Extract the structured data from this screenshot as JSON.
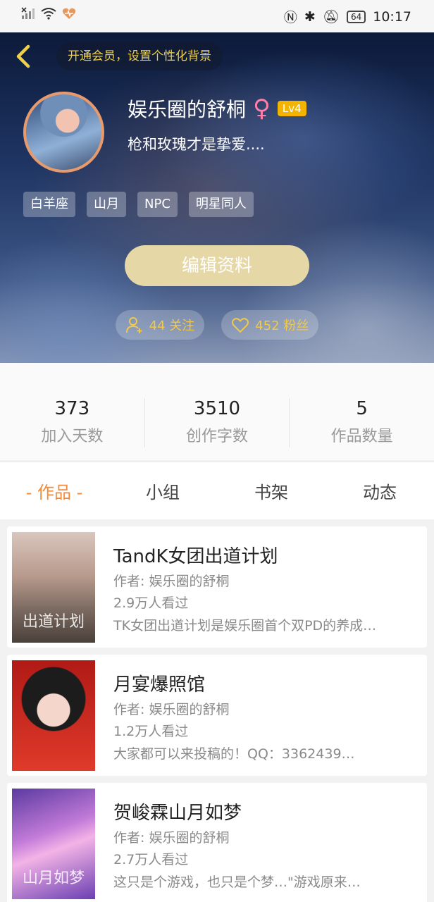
{
  "status_bar": {
    "battery": "64",
    "time": "10:17"
  },
  "header": {
    "vip_prompt": "开通会员，设置个性化背景",
    "username": "娱乐圈的舒桐",
    "gender_symbol": "♀",
    "level": "Lv4",
    "signature": "枪和玫瑰才是挚爱....",
    "tags": [
      "白羊座",
      "山月",
      "NPC",
      "明星同人"
    ],
    "edit_label": "编辑资料",
    "following": "44 关注",
    "fans": "452 粉丝"
  },
  "stats": [
    {
      "value": "373",
      "label": "加入天数"
    },
    {
      "value": "3510",
      "label": "创作字数"
    },
    {
      "value": "5",
      "label": "作品数量"
    }
  ],
  "tabs": [
    "- 作品 -",
    "小组",
    "书架",
    "动态"
  ],
  "works": [
    {
      "title": "TandK女团出道计划",
      "author": "作者: 娱乐圈的舒桐",
      "views": "2.9万人看过",
      "desc": "TK女团出道计划是娱乐圈首个双PD的养成…",
      "cover_text": "出道计划"
    },
    {
      "title": "月宴爆照馆",
      "author": "作者: 娱乐圈的舒桐",
      "views": "1.2万人看过",
      "desc": "大家都可以来投稿的！QQ：3362439…",
      "cover_text": ""
    },
    {
      "title": "贺峻霖山月如梦",
      "author": "作者: 娱乐圈的舒桐",
      "views": "2.7万人看过",
      "desc": "这只是个游戏，也只是个梦…\"游戏原来…",
      "cover_text": "山月如梦"
    }
  ]
}
